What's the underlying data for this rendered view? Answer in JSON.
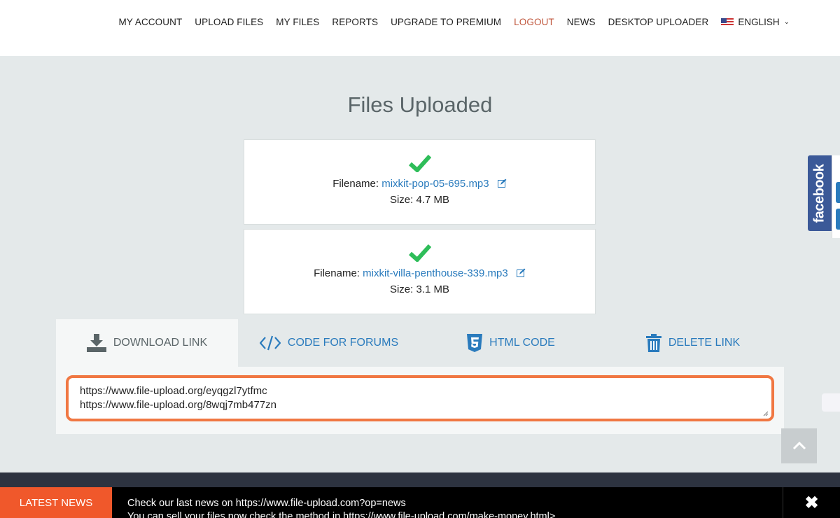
{
  "nav": {
    "items": [
      "MY ACCOUNT",
      "UPLOAD FILES",
      "MY FILES",
      "REPORTS",
      "UPGRADE TO PREMIUM",
      "LOGOUT",
      "NEWS",
      "DESKTOP UPLOADER"
    ],
    "language": "ENGLISH",
    "language_flag_icon": "us-flag-icon",
    "active_color": "#c0573d"
  },
  "page_title": "Files Uploaded",
  "files": [
    {
      "filename_label": "Filename:",
      "filename": "mixkit-pop-05-695.mp3",
      "size_label": "Size: 4.7 MB",
      "status_icon": "check-icon"
    },
    {
      "filename_label": "Filename:",
      "filename": "mixkit-villa-penthouse-339.mp3",
      "size_label": "Size: 3.1 MB",
      "status_icon": "check-icon"
    }
  ],
  "tabs": [
    {
      "label": "DOWNLOAD LINK",
      "icon": "download-icon",
      "active": true
    },
    {
      "label": "CODE FOR FORUMS",
      "icon": "code-icon",
      "active": false
    },
    {
      "label": "HTML CODE",
      "icon": "html5-icon",
      "active": false
    },
    {
      "label": "DELETE LINK",
      "icon": "trash-icon",
      "active": false
    }
  ],
  "links": [
    "https://www.file-upload.org/eyqgzl7ytfmc",
    "https://www.file-upload.org/8wqj7mb477zn"
  ],
  "facebook_label": "facebook",
  "news": {
    "label": "LATEST NEWS",
    "line1": "Check our last news on https://www.file-upload.com?op=news",
    "line2": "You can sell your files now check the method in https://www.file-upload.com/make-money.html>"
  },
  "colors": {
    "accent": "#2a7bbd",
    "highlight": "#f07742",
    "news": "#f0582b",
    "facebook": "#3b5998",
    "check": "#2ebd59"
  }
}
